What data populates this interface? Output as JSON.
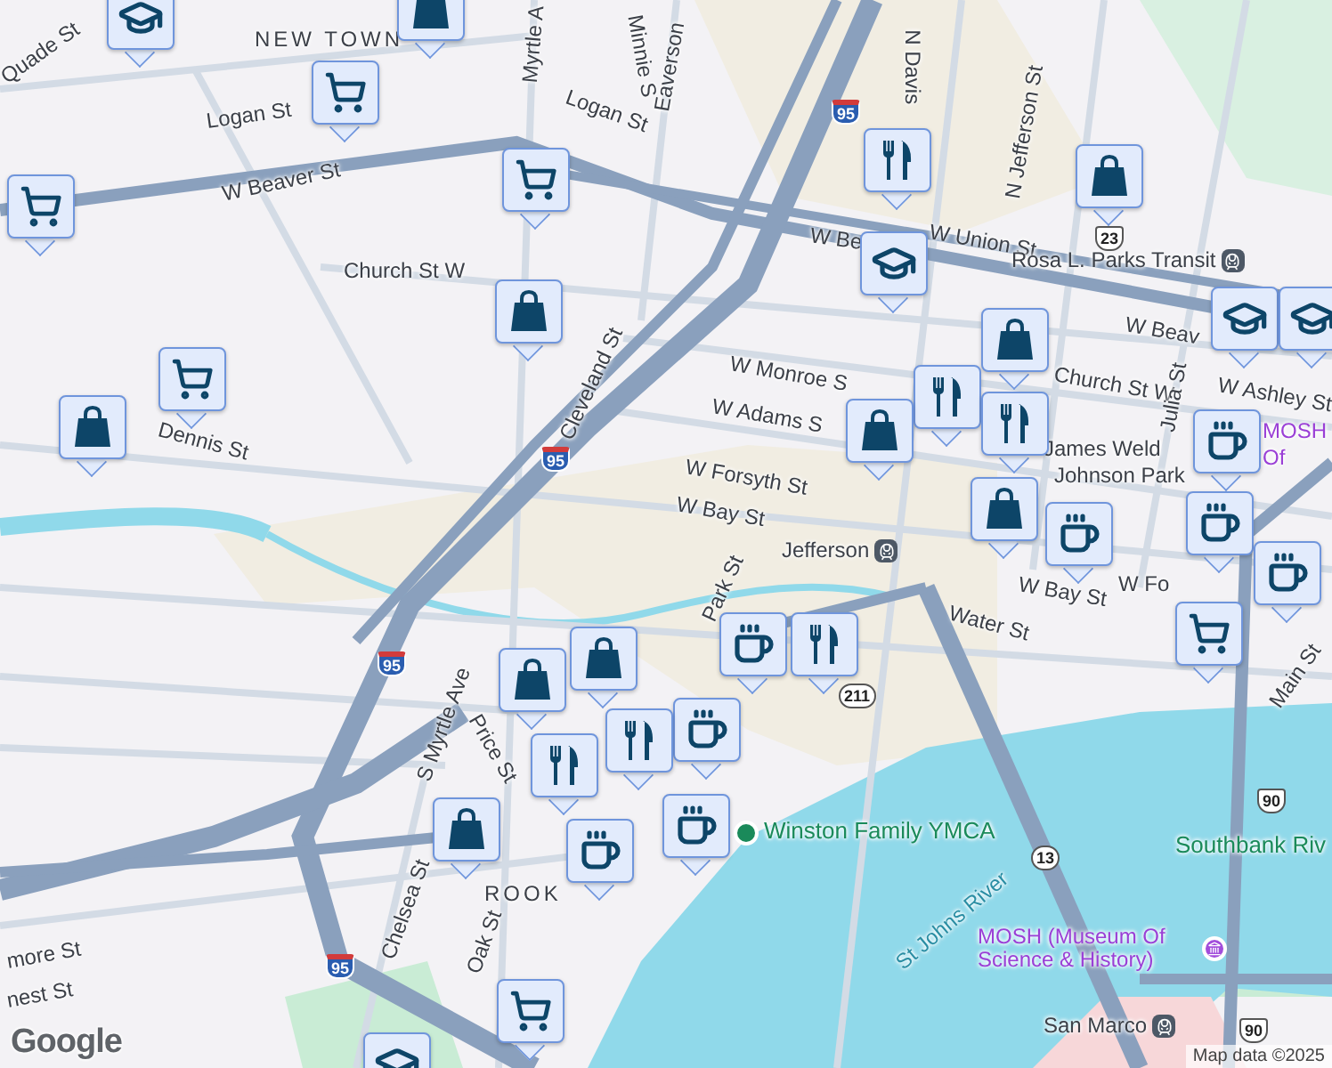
{
  "labels": [
    {
      "text": "Quade St",
      "kind": "street"
    },
    {
      "text": "NEW TOWN",
      "kind": "district"
    },
    {
      "text": "Logan St",
      "kind": "street"
    },
    {
      "text": "Myrtle A",
      "kind": "street"
    },
    {
      "text": "Minnie S",
      "kind": "street"
    },
    {
      "text": "Eaverson",
      "kind": "street"
    },
    {
      "text": "Logan St",
      "kind": "street"
    },
    {
      "text": "W Beaver St",
      "kind": "street"
    },
    {
      "text": "Church St W",
      "kind": "street"
    },
    {
      "text": "Cleveland St",
      "kind": "street"
    },
    {
      "text": "Dennis St",
      "kind": "street"
    },
    {
      "text": "N Davis",
      "kind": "street"
    },
    {
      "text": "N Jefferson St",
      "kind": "street"
    },
    {
      "text": "W Be",
      "kind": "street"
    },
    {
      "text": "W Union St",
      "kind": "street"
    },
    {
      "text": "Rosa L. Parks Transit",
      "kind": "transit"
    },
    {
      "text": "W Beav",
      "kind": "street"
    },
    {
      "text": "Church St W",
      "kind": "street"
    },
    {
      "text": "Julia St",
      "kind": "street"
    },
    {
      "text": "W Ashley St",
      "kind": "street"
    },
    {
      "text": "W Monroe S",
      "kind": "street"
    },
    {
      "text": "W Adams S",
      "kind": "street"
    },
    {
      "text": "W Forsyth St",
      "kind": "street"
    },
    {
      "text": "W Bay St",
      "kind": "street"
    },
    {
      "text": "James Weld",
      "kind": "park"
    },
    {
      "text": "Johnson Park",
      "kind": "park"
    },
    {
      "text": "MOSH",
      "kind": "museum"
    },
    {
      "text": "Of",
      "kind": "museum"
    },
    {
      "text": "Jefferson",
      "kind": "transit"
    },
    {
      "text": "W Bay St",
      "kind": "street"
    },
    {
      "text": "W Fo",
      "kind": "street"
    },
    {
      "text": "Park St",
      "kind": "street"
    },
    {
      "text": "Water St",
      "kind": "street"
    },
    {
      "text": "Main St",
      "kind": "street"
    },
    {
      "text": "S Myrtle Ave",
      "kind": "street"
    },
    {
      "text": "Price St",
      "kind": "street"
    },
    {
      "text": "ROOK",
      "kind": "district"
    },
    {
      "text": "Chelsea St",
      "kind": "street"
    },
    {
      "text": "Oak St",
      "kind": "street"
    },
    {
      "text": "more St",
      "kind": "street"
    },
    {
      "text": "nest St",
      "kind": "street"
    },
    {
      "text": "Winston Family YMCA",
      "kind": "gym"
    },
    {
      "text": "Southbank Riv",
      "kind": "gym"
    },
    {
      "text": "St Johns River",
      "kind": "water"
    },
    {
      "text": "MOSH (Museum Of Science & History)",
      "kind": "museum"
    },
    {
      "text": "San Marco",
      "kind": "transit"
    }
  ],
  "shields": [
    {
      "text": "95",
      "kind": "interstate"
    },
    {
      "text": "95",
      "kind": "interstate"
    },
    {
      "text": "95",
      "kind": "interstate"
    },
    {
      "text": "95",
      "kind": "interstate"
    },
    {
      "text": "23",
      "kind": "us"
    },
    {
      "text": "211",
      "kind": "state"
    },
    {
      "text": "13",
      "kind": "state"
    },
    {
      "text": "90",
      "kind": "us"
    },
    {
      "text": "90",
      "kind": "us"
    }
  ],
  "markers": [
    {
      "kind": "school"
    },
    {
      "kind": "shop"
    },
    {
      "kind": "grocery"
    },
    {
      "kind": "grocery"
    },
    {
      "kind": "grocery"
    },
    {
      "kind": "food"
    },
    {
      "kind": "shop"
    },
    {
      "kind": "school"
    },
    {
      "kind": "shop"
    },
    {
      "kind": "grocery"
    },
    {
      "kind": "shop"
    },
    {
      "kind": "shop"
    },
    {
      "kind": "food"
    },
    {
      "kind": "food"
    },
    {
      "kind": "shop"
    },
    {
      "kind": "school"
    },
    {
      "kind": "school"
    },
    {
      "kind": "cafe"
    },
    {
      "kind": "shop"
    },
    {
      "kind": "cafe"
    },
    {
      "kind": "cafe"
    },
    {
      "kind": "cafe"
    },
    {
      "kind": "grocery"
    },
    {
      "kind": "food"
    },
    {
      "kind": "cafe"
    },
    {
      "kind": "cafe"
    },
    {
      "kind": "shop"
    },
    {
      "kind": "shop"
    },
    {
      "kind": "food"
    },
    {
      "kind": "food"
    },
    {
      "kind": "cafe"
    },
    {
      "kind": "shop"
    },
    {
      "kind": "cafe"
    },
    {
      "kind": "grocery"
    },
    {
      "kind": "school"
    }
  ],
  "attribution": "Map data ©2025",
  "logo": "Google"
}
